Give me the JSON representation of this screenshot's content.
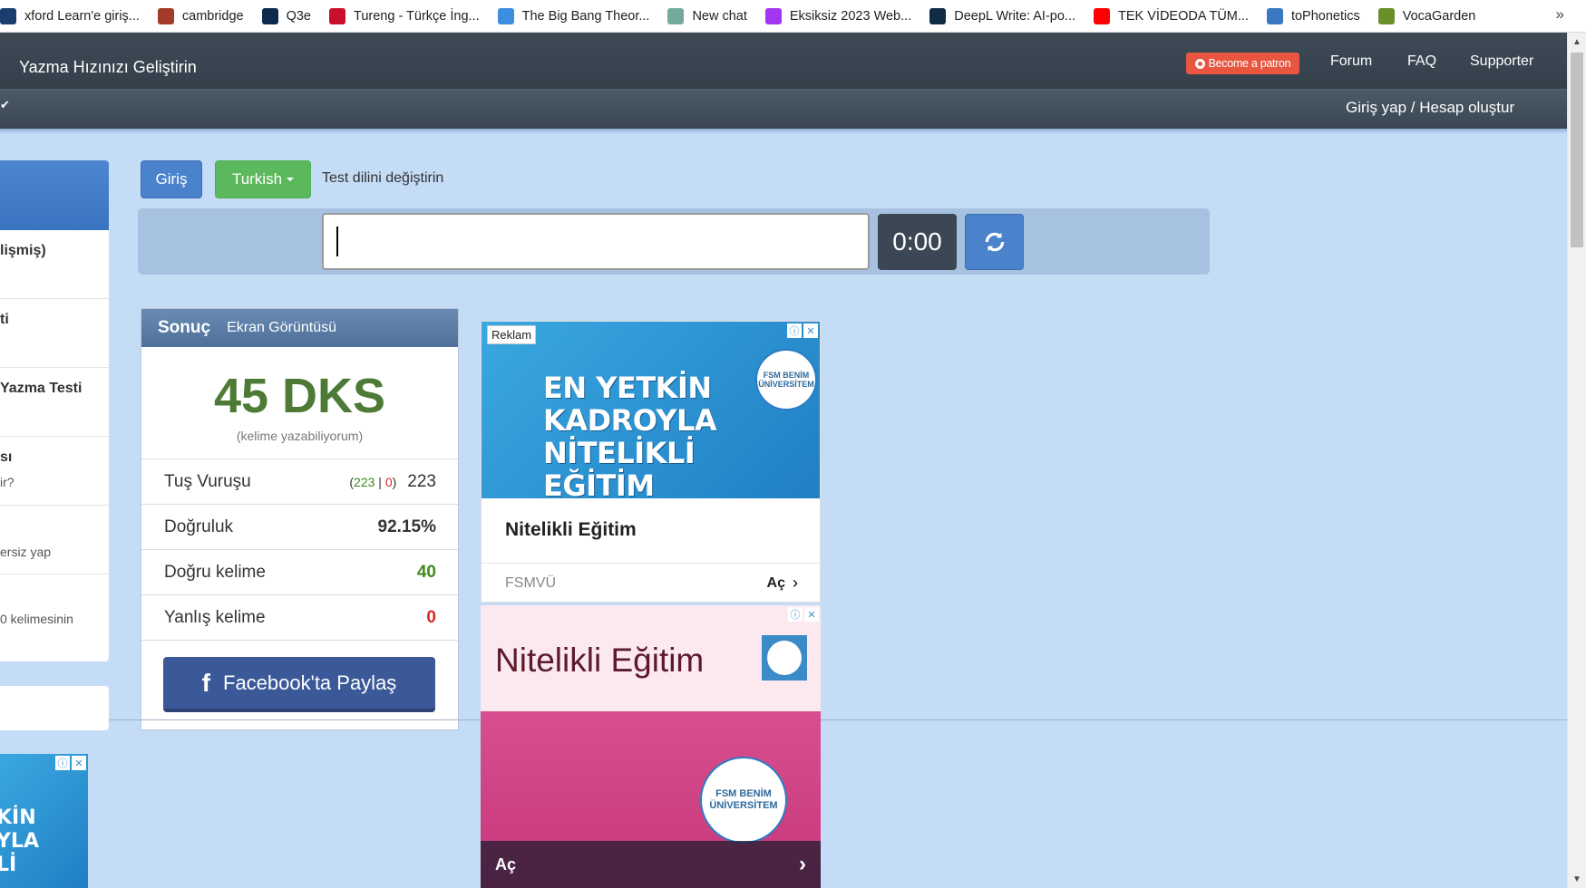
{
  "bookmarks": [
    {
      "label": "xford Learn'e giriş...",
      "icon": "oxford-icon",
      "color": "#1a3d6e"
    },
    {
      "label": "cambridge",
      "icon": "cambridge-shield-icon",
      "color": "#a23b2a"
    },
    {
      "label": "Q3e",
      "icon": "q3e-icon",
      "color": "#0c2a4d"
    },
    {
      "label": "Tureng - Türkçe İng...",
      "icon": "tureng-icon",
      "color": "#c8102e"
    },
    {
      "label": "The Big Bang Theor...",
      "icon": "diamond-icon",
      "color": "#3d8ee0"
    },
    {
      "label": "New chat",
      "icon": "chatgpt-icon",
      "color": "#74aa9c"
    },
    {
      "label": "Eksiksiz 2023 Web...",
      "icon": "udemy-icon",
      "color": "#a435f0"
    },
    {
      "label": "DeepL Write: AI-po...",
      "icon": "deepl-icon",
      "color": "#0f2b46"
    },
    {
      "label": "TEK VİDEODA TÜM...",
      "icon": "youtube-icon",
      "color": "#ff0000"
    },
    {
      "label": "toPhonetics",
      "icon": "tophonetics-icon",
      "color": "#3a78c2"
    },
    {
      "label": "VocaGarden",
      "icon": "leaf-icon",
      "color": "#6a8f2b"
    }
  ],
  "bookmarks_more": "»",
  "navbar": {
    "brand": "Yazma Hızınızı Geliştirin",
    "patron_label": "Become a patron",
    "links": [
      "Forum",
      "FAQ",
      "Supporter"
    ],
    "login_label": "Giriş yap / Hesap oluştur"
  },
  "sidebar": {
    "items": [
      {
        "label": "lişmiş)",
        "sub": ""
      },
      {
        "label": "ti",
        "sub": ""
      },
      {
        "label": "Yazma Testi",
        "sub": ""
      },
      {
        "label": "sı",
        "sub": "ir?"
      },
      {
        "label": "",
        "sub": "ersiz yap"
      },
      {
        "label": "",
        "sub": "0 kelimesinin"
      }
    ]
  },
  "controls": {
    "giris_label": "Giriş",
    "language_label": "Turkish",
    "language_hint": "Test dilini değiştirin",
    "input_value": "",
    "timer": "0:00"
  },
  "result": {
    "title": "Sonuç",
    "screenshot_label": "Ekran Görüntüsü",
    "wpm": "45 DKS",
    "wpm_caption": "(kelime yazabiliyorum)",
    "keystrokes_label": "Tuş Vuruşu",
    "keystrokes_correct": "223",
    "keystrokes_sep": " | ",
    "keystrokes_wrong": "0",
    "keystrokes_total": "223",
    "accuracy_label": "Doğruluk",
    "accuracy_value": "92.15%",
    "correct_words_label": "Doğru kelime",
    "correct_words_value": "40",
    "wrong_words_label": "Yanlış kelime",
    "wrong_words_value": "0",
    "facebook_label": "Facebook'ta Paylaş"
  },
  "ads": {
    "badge": "Reklam",
    "ad1_headline": "EN YETKİN KADROYLA NİTELİKLİ EĞİTİM VERİR.",
    "ad1_logo": "FSM BENİM ÜNİVERSİTEM",
    "ad1_title": "Nitelikli Eğitim",
    "ad1_source": "FSMVÜ",
    "ad1_open": "Aç",
    "ad2_title": "Nitelikli Eğitim",
    "ad2_logo": "FSM BENİM ÜNİVERSİTEM",
    "ad2_open": "Aç",
    "ad3_headline": "KİN YLA Lİ"
  },
  "colors": {
    "page_bg": "#c5dcf7",
    "navbar": "#2c3640",
    "primary_button": "#4a82cb",
    "success_button": "#5cb85c",
    "wpm_green": "#4d7a35",
    "facebook": "#3b5998"
  }
}
